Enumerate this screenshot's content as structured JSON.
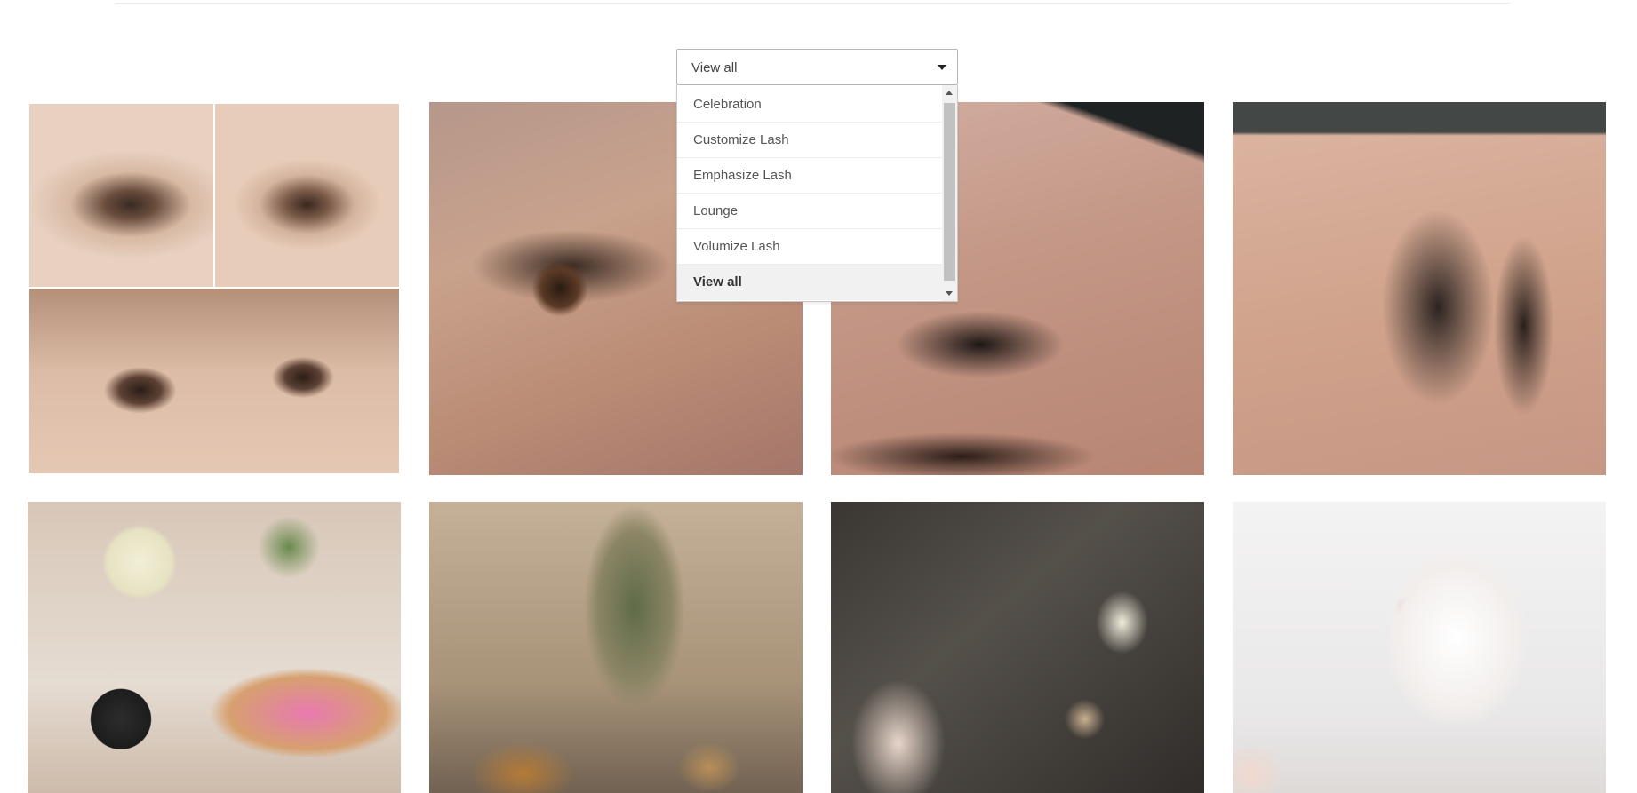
{
  "filter": {
    "selected_value": "View all",
    "options": [
      "Celebration",
      "Customize Lash",
      "Emphasize Lash",
      "Lounge",
      "Volumize Lash",
      "View all"
    ]
  }
}
